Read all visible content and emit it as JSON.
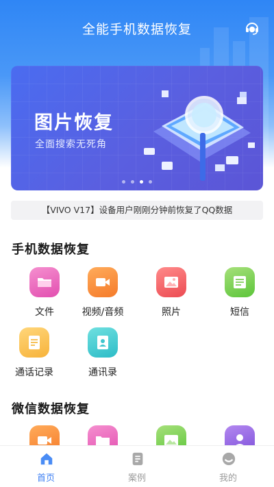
{
  "app": {
    "title": "全能手机数据恢复"
  },
  "banner": {
    "title": "图片恢复",
    "subtitle": "全面搜索无死角",
    "page_count": 4,
    "active_page": 3
  },
  "notice": {
    "text": "【VIVO V17】设备用户刚刚分钟前恢复了QQ数据"
  },
  "phone_section": {
    "title": "手机数据恢复",
    "items": [
      {
        "label": "文件",
        "icon": "folder-icon",
        "color_from": "#f58fcf",
        "color_to": "#e24fb0"
      },
      {
        "label": "视频/音频",
        "icon": "video-camera-icon",
        "color_from": "#ffab5a",
        "color_to": "#f57b2a"
      },
      {
        "label": "照片",
        "icon": "photo-icon",
        "color_from": "#ff8a8a",
        "color_to": "#ec4b52"
      },
      {
        "label": "短信",
        "icon": "message-icon",
        "color_from": "#a6e07a",
        "color_to": "#5cc53a"
      },
      {
        "label": "通话记录",
        "icon": "call-log-icon",
        "color_from": "#ffd67a",
        "color_to": "#f7b33b"
      },
      {
        "label": "通讯录",
        "icon": "contacts-icon",
        "color_from": "#6fe0e0",
        "color_to": "#2cbcc7"
      }
    ]
  },
  "wechat_section": {
    "title": "微信数据恢复",
    "items": [
      {
        "icon": "video-camera-icon",
        "color_from": "#ffab5a",
        "color_to": "#f57b2a"
      },
      {
        "icon": "folder-icon",
        "color_from": "#f58fcf",
        "color_to": "#e24fb0"
      },
      {
        "icon": "photo-icon",
        "color_from": "#a6e07a",
        "color_to": "#5cc53a"
      },
      {
        "icon": "contact-person-icon",
        "color_from": "#b388f0",
        "color_to": "#7c4fd9"
      }
    ]
  },
  "tabs": [
    {
      "label": "首页",
      "icon": "home-icon",
      "active": true
    },
    {
      "label": "案例",
      "icon": "document-icon",
      "active": false
    },
    {
      "label": "我的",
      "icon": "profile-icon",
      "active": false
    }
  ],
  "colors": {
    "accent": "#3d7ff3",
    "header": "#2f86f5",
    "banner": "#5a5fe0",
    "tab_inactive": "#9a9a9a"
  }
}
